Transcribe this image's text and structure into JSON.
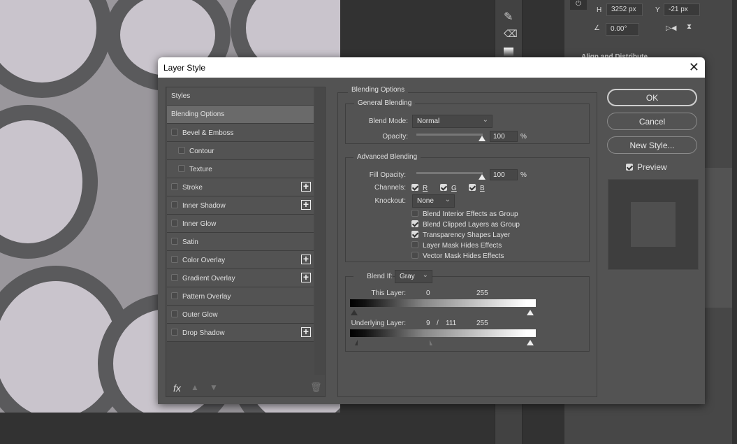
{
  "background": {
    "properties": {
      "h_label": "H",
      "h_value": "3252 px",
      "y_label": "Y",
      "y_value": "-21 px",
      "angle_value": "0.00°",
      "section_title": "Align and Distribute"
    }
  },
  "dialog": {
    "title": "Layer Style",
    "styles_list": [
      {
        "label": "Styles",
        "checkbox": false,
        "indent": false,
        "plus": false,
        "selected": false,
        "header": true
      },
      {
        "label": "Blending Options",
        "checkbox": false,
        "indent": false,
        "plus": false,
        "selected": true,
        "header": true
      },
      {
        "label": "Bevel & Emboss",
        "checkbox": true,
        "checked": false,
        "indent": false,
        "plus": false
      },
      {
        "label": "Contour",
        "checkbox": true,
        "checked": false,
        "indent": true,
        "plus": false
      },
      {
        "label": "Texture",
        "checkbox": true,
        "checked": false,
        "indent": true,
        "plus": false
      },
      {
        "label": "Stroke",
        "checkbox": true,
        "checked": false,
        "indent": false,
        "plus": true
      },
      {
        "label": "Inner Shadow",
        "checkbox": true,
        "checked": false,
        "indent": false,
        "plus": true
      },
      {
        "label": "Inner Glow",
        "checkbox": true,
        "checked": false,
        "indent": false,
        "plus": false
      },
      {
        "label": "Satin",
        "checkbox": true,
        "checked": false,
        "indent": false,
        "plus": false
      },
      {
        "label": "Color Overlay",
        "checkbox": true,
        "checked": false,
        "indent": false,
        "plus": true
      },
      {
        "label": "Gradient Overlay",
        "checkbox": true,
        "checked": false,
        "indent": false,
        "plus": true
      },
      {
        "label": "Pattern Overlay",
        "checkbox": true,
        "checked": false,
        "indent": false,
        "plus": false
      },
      {
        "label": "Outer Glow",
        "checkbox": true,
        "checked": false,
        "indent": false,
        "plus": false
      },
      {
        "label": "Drop Shadow",
        "checkbox": true,
        "checked": false,
        "indent": false,
        "plus": true
      }
    ],
    "footer": {
      "fx_label": "fx"
    },
    "blending": {
      "title": "Blending Options",
      "general_title": "General Blending",
      "blend_mode_label": "Blend Mode:",
      "blend_mode_value": "Normal",
      "opacity_label": "Opacity:",
      "opacity_value": "100",
      "percent": "%",
      "advanced_title": "Advanced Blending",
      "fill_opacity_label": "Fill Opacity:",
      "fill_opacity_value": "100",
      "channels_label": "Channels:",
      "channels": [
        {
          "label": "R",
          "checked": true
        },
        {
          "label": "G",
          "checked": true
        },
        {
          "label": "B",
          "checked": true
        }
      ],
      "knockout_label": "Knockout:",
      "knockout_value": "None",
      "options": [
        {
          "label": "Blend Interior Effects as Group",
          "checked": false
        },
        {
          "label": "Blend Clipped Layers as Group",
          "checked": true
        },
        {
          "label": "Transparency Shapes Layer",
          "checked": true
        },
        {
          "label": "Layer Mask Hides Effects",
          "checked": false
        },
        {
          "label": "Vector Mask Hides Effects",
          "checked": false
        }
      ],
      "blend_if_label": "Blend If:",
      "blend_if_value": "Gray",
      "this_layer_label": "This Layer:",
      "this_layer_low": "0",
      "this_layer_high": "255",
      "underlying_label": "Underlying Layer:",
      "underlying_low_a": "9",
      "underlying_sep": "/",
      "underlying_low_b": "111",
      "underlying_high": "255"
    },
    "buttons": {
      "ok": "OK",
      "cancel": "Cancel",
      "new_style": "New Style...",
      "preview_label": "Preview",
      "preview_checked": true
    }
  }
}
